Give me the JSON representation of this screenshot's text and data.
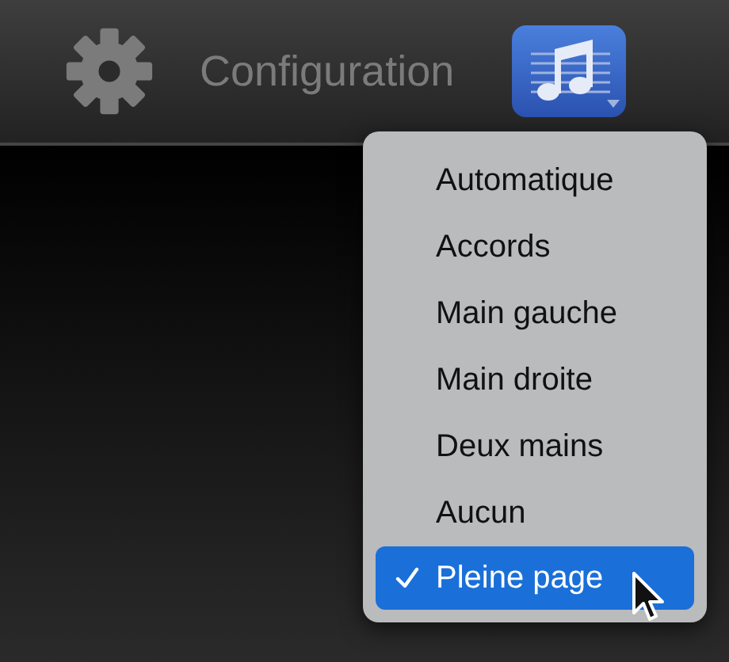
{
  "toolbar": {
    "title": "Configuration",
    "music_button": {
      "selected": true
    }
  },
  "menu": {
    "items": [
      {
        "label": "Automatique",
        "selected": false
      },
      {
        "label": "Accords",
        "selected": false
      },
      {
        "label": "Main gauche",
        "selected": false
      },
      {
        "label": "Main droite",
        "selected": false
      },
      {
        "label": "Deux mains",
        "selected": false
      },
      {
        "label": "Aucun",
        "selected": false
      },
      {
        "label": "Pleine page",
        "selected": true
      }
    ]
  }
}
